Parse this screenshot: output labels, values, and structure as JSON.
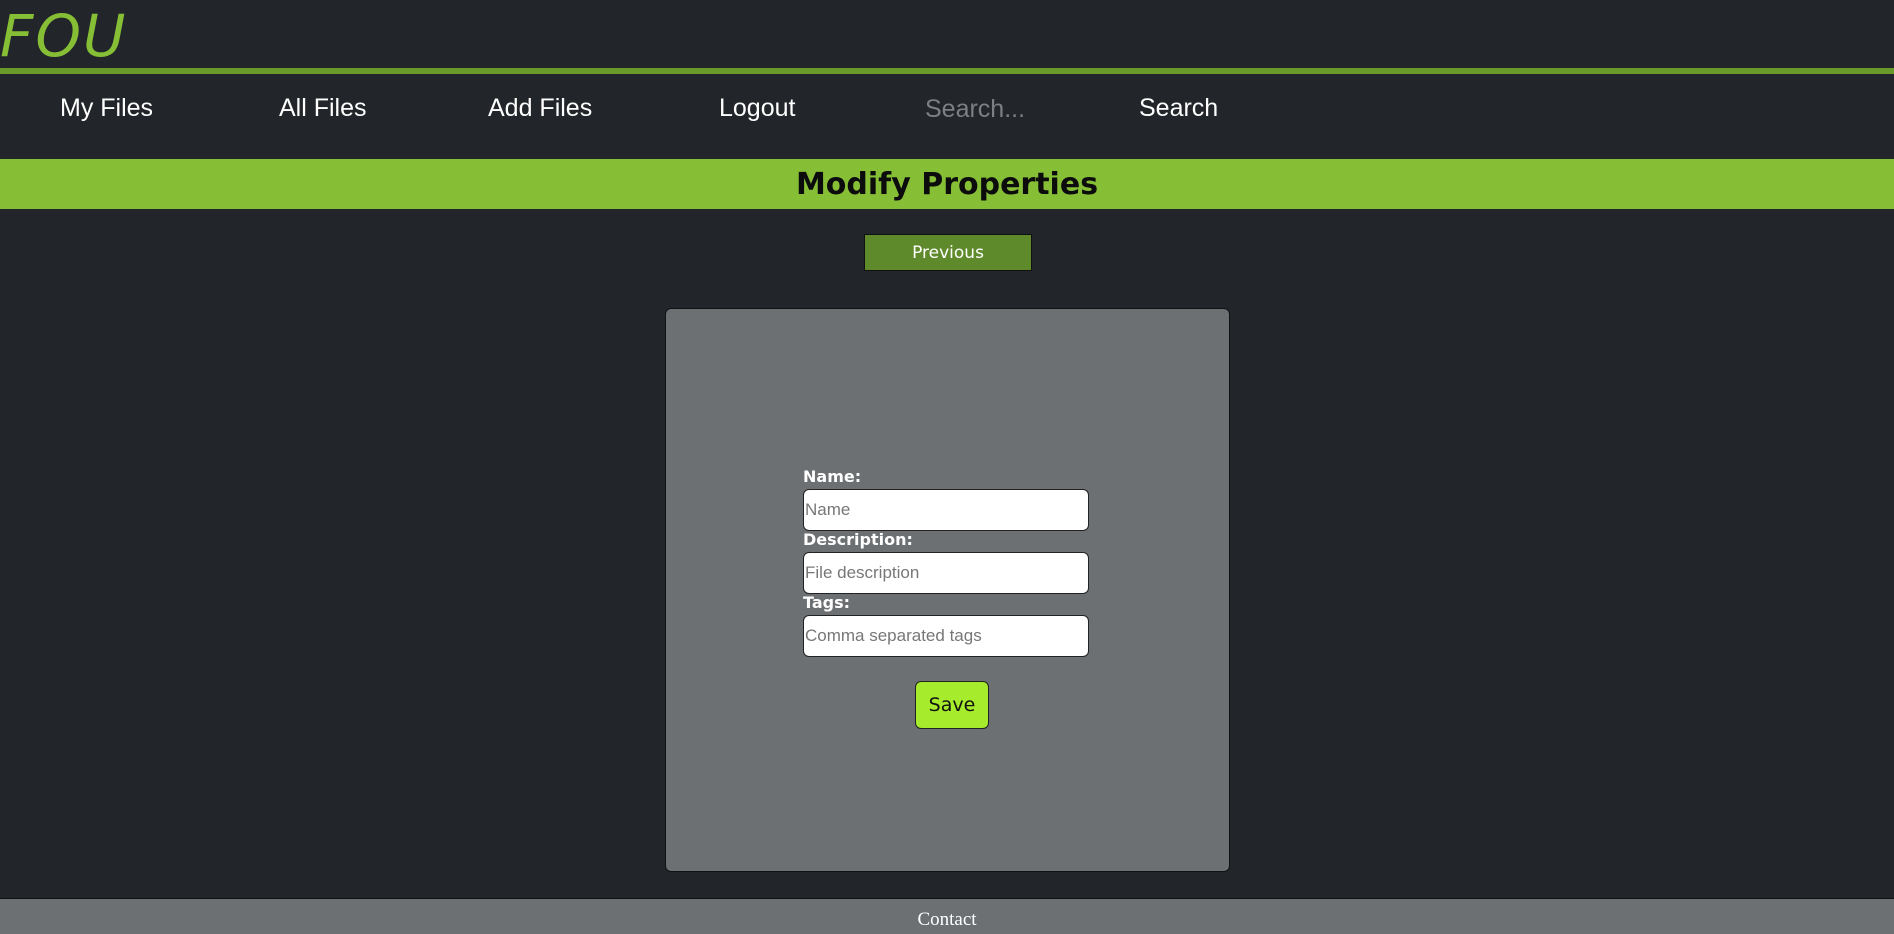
{
  "logo": "FOU",
  "nav": {
    "my_files": "My Files",
    "all_files": "All Files",
    "add_files": "Add Files",
    "logout": "Logout",
    "search_placeholder": "Search...",
    "search_button": "Search"
  },
  "page_title": "Modify Properties",
  "previous_button": "Previous",
  "form": {
    "name_label": "Name:",
    "name_placeholder": "Name",
    "name_value": "",
    "description_label": "Description:",
    "description_placeholder": "File description",
    "description_value": "",
    "tags_label": "Tags:",
    "tags_placeholder": "Comma separated tags",
    "tags_value": "",
    "save_button": "Save"
  },
  "footer": {
    "contact": "Contact"
  },
  "colors": {
    "background": "#222529",
    "accent": "#86bf36",
    "header_rule": "#6a9a2a",
    "previous_button": "#5f8a2c",
    "panel": "#6c7073",
    "save_button": "#a6ec2c"
  }
}
